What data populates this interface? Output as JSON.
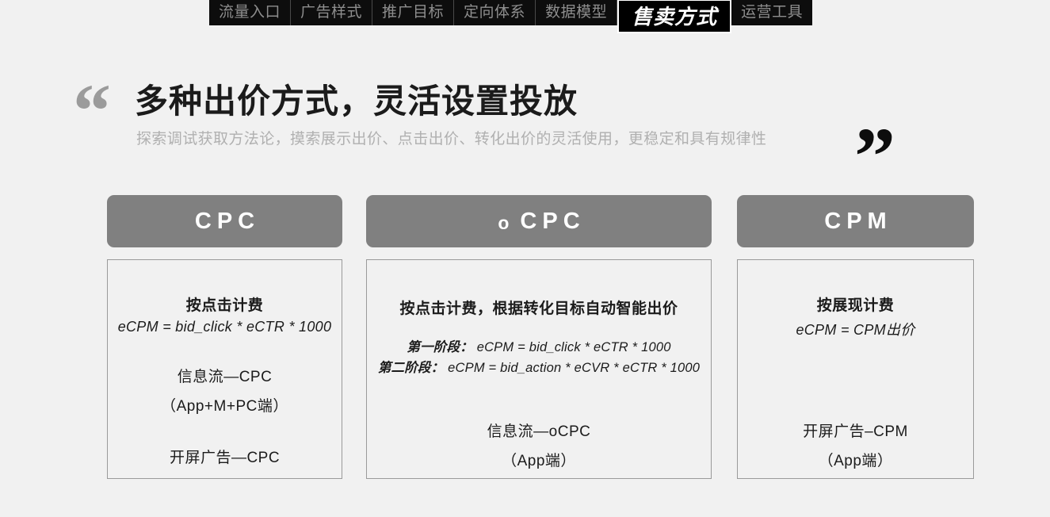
{
  "tabbar": {
    "tabs": [
      {
        "label": "流量入口",
        "active": false
      },
      {
        "label": "广告样式",
        "active": false
      },
      {
        "label": "推广目标",
        "active": false
      },
      {
        "label": "定向体系",
        "active": false
      },
      {
        "label": "数据模型",
        "active": false
      },
      {
        "label": "售卖方式",
        "active": true
      },
      {
        "label": "运营工具",
        "active": false
      }
    ]
  },
  "headline": {
    "quote_open": "“",
    "quote_close": "”",
    "title": "多种出价方式，灵活设置投放",
    "subtitle": "探索调试获取方法论，摸索展示出价、点击出价、转化出价的灵活使用，更稳定和具有规律性"
  },
  "columns": [
    {
      "id": "cpc",
      "header_main": "CPC",
      "header_lower": "",
      "lines": {
        "billing": "按点击计费",
        "formula": "eCPM = bid_click * eCTR * 1000",
        "channel_1": "信息流—CPC",
        "channel_1_sub": "（App+M+PC端）",
        "channel_2": "开屏广告—CPC"
      }
    },
    {
      "id": "ocpc",
      "header_main": "CPC",
      "header_lower": "o",
      "lines": {
        "billing": "按点击计费，根据转化目标自动智能出价",
        "stage_1_label": "第一阶段：",
        "stage_1_formula": "eCPM = bid_click * eCTR * 1000",
        "stage_2_label": "第二阶段：",
        "stage_2_formula": "eCPM = bid_action * eCVR * eCTR * 1000",
        "channel_1": "信息流—oCPC",
        "channel_1_sub": "（App端）"
      }
    },
    {
      "id": "cpm",
      "header_main": "CPM",
      "header_lower": "",
      "lines": {
        "billing": "按展现计费",
        "formula": "eCPM = CPM出价",
        "channel_1": "开屏广告–CPM",
        "channel_1_sub": "（App端）"
      }
    }
  ],
  "colors": {
    "background": "#f1f1f1",
    "header_gray": "#808080",
    "tab_bar_black": "#0d0d0d",
    "tab_inactive_text": "#8e8e8e",
    "tab_active_text": "#ffffff",
    "title_text": "#1b1b1b",
    "subtitle_text": "#b0b0b0",
    "box_border": "#9a9a9a",
    "quote_open_color": "#9b9b9b",
    "quote_close_color": "#0d0d0d"
  }
}
